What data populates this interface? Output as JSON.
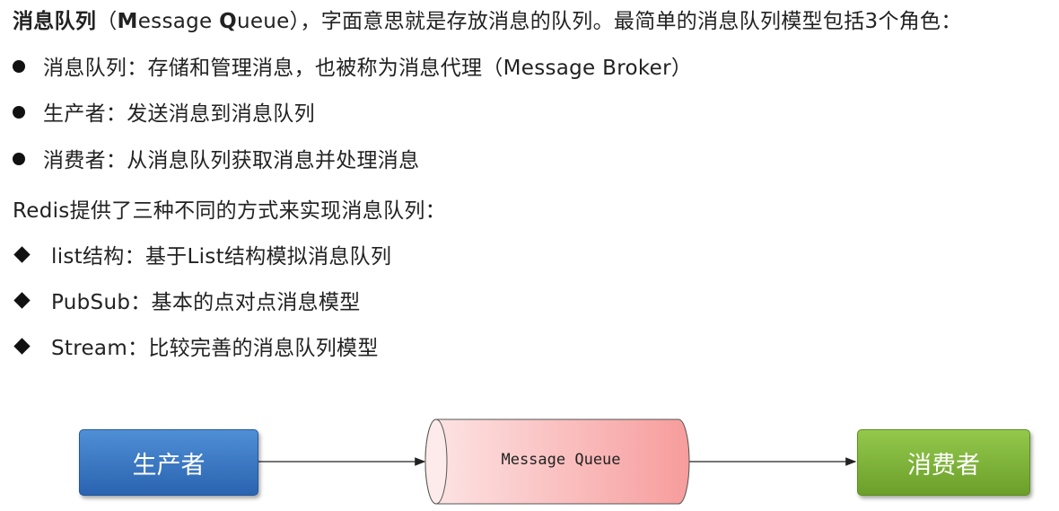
{
  "intro": {
    "bold_term": "消息队列",
    "paren_open": "（",
    "bold_m": "M",
    "essage": "essage ",
    "bold_q": "Q",
    "ueue": "ueue",
    "rest": "），字面意思就是存放消息的队列。最简单的消息队列模型包括3个角色："
  },
  "roles": [
    "消息队列：存储和管理消息，也被称为消息代理（Message Broker）",
    "生产者：发送消息到消息队列",
    "消费者：从消息队列获取消息并处理消息"
  ],
  "redis_heading": "Redis提供了三种不同的方式来实现消息队列：",
  "methods": [
    "list结构：基于List结构模拟消息队列",
    "PubSub：基本的点对点消息模型",
    "Stream：比较完善的消息队列模型"
  ],
  "diagram": {
    "producer_label": "生产者",
    "queue_label": "Message Queue",
    "consumer_label": "消费者",
    "colors": {
      "producer": "#3a76c4",
      "queue": "#f7a9a9",
      "consumer": "#7fb43a"
    }
  }
}
